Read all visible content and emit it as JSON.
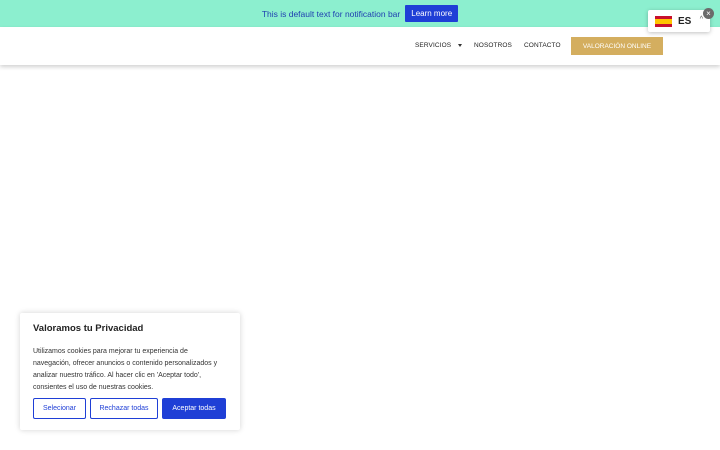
{
  "notification_bar": {
    "text": "This is default text for notification bar",
    "button_label": "Learn more",
    "close_glyph": "×"
  },
  "nav": {
    "items": [
      {
        "label": "SERVICIOS",
        "has_dropdown": true
      },
      {
        "label": "NOSOTROS"
      },
      {
        "label": "CONTACTO"
      }
    ],
    "cta_label": "VALORACIÓN ONLINE"
  },
  "language_switcher": {
    "code": "ES",
    "flag_icon": "spain-flag-icon",
    "chevron": "^"
  },
  "cookie_banner": {
    "title": "Valoramos tu Privacidad",
    "text": "Utilizamos cookies para mejorar tu experiencia de navegación, ofrecer anuncios o contenido personalizados y analizar nuestro tráfico. Al hacer clic en 'Aceptar todo', consientes el uso de nuestras cookies.",
    "buttons": {
      "select": "Selecionar",
      "reject": "Rechazar todas",
      "accept": "Aceptar todas"
    }
  },
  "colors": {
    "notification_bg": "#8cefcf",
    "primary_blue": "#1f3fd6",
    "cta_gold": "#d4ae5f"
  }
}
